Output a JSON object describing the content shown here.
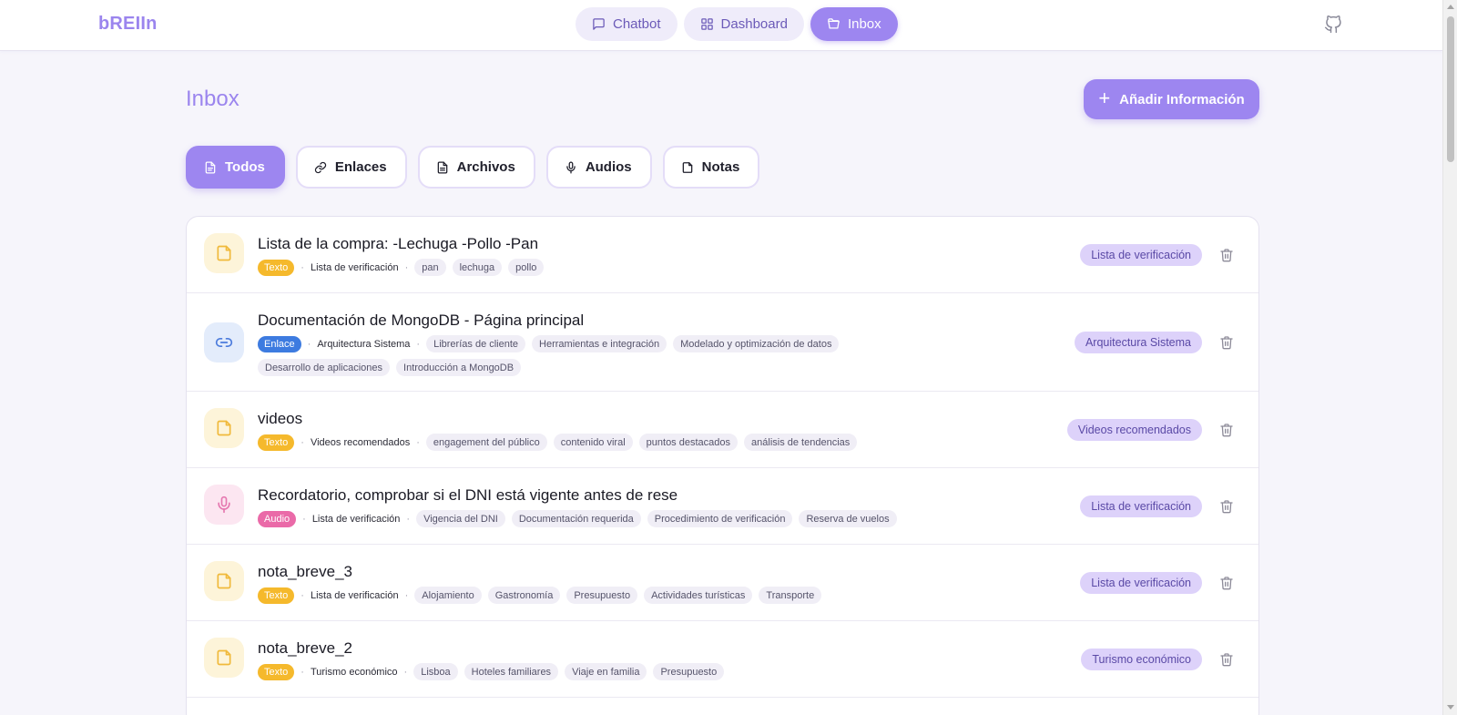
{
  "brand": "bREIIn",
  "nav": [
    {
      "label": "Chatbot",
      "icon": "chat-icon"
    },
    {
      "label": "Dashboard",
      "icon": "dashboard-icon"
    },
    {
      "label": "Inbox",
      "icon": "folder-open-icon"
    }
  ],
  "page": {
    "title": "Inbox",
    "add_button": "Añadir Información"
  },
  "filters": [
    {
      "label": "Todos",
      "icon": "document-icon",
      "active": true
    },
    {
      "label": "Enlaces",
      "icon": "link-icon"
    },
    {
      "label": "Archivos",
      "icon": "file-text-icon"
    },
    {
      "label": "Audios",
      "icon": "mic-icon"
    },
    {
      "label": "Notas",
      "icon": "note-icon"
    }
  ],
  "items": [
    {
      "title": "Lista de la compra: -Lechuga -Pollo -Pan",
      "type": "Texto",
      "category": "Lista de verificación",
      "tags": [
        "pan",
        "lechuga",
        "pollo"
      ],
      "pill": "Lista de verificación"
    },
    {
      "title": "Documentación de MongoDB - Página principal",
      "type": "Enlace",
      "category": "Arquitectura Sistema",
      "tags": [
        "Librerías de cliente",
        "Herramientas e integración",
        "Modelado y optimización de datos",
        "Desarrollo de aplicaciones",
        "Introducción a MongoDB"
      ],
      "pill": "Arquitectura Sistema"
    },
    {
      "title": "videos",
      "type": "Texto",
      "category": "Videos recomendados",
      "tags": [
        "engagement del público",
        "contenido viral",
        "puntos destacados",
        "análisis de tendencias"
      ],
      "pill": "Videos recomendados"
    },
    {
      "title": "Recordatorio, comprobar si el DNI está vigente antes de rese",
      "type": "Audio",
      "category": "Lista de verificación",
      "tags": [
        "Vigencia del DNI",
        "Documentación requerida",
        "Procedimiento de verificación",
        "Reserva de vuelos"
      ],
      "pill": "Lista de verificación"
    },
    {
      "title": "nota_breve_3",
      "type": "Texto",
      "category": "Lista de verificación",
      "tags": [
        "Alojamiento",
        "Gastronomía",
        "Presupuesto",
        "Actividades turísticas",
        "Transporte"
      ],
      "pill": "Lista de verificación"
    },
    {
      "title": "nota_breve_2",
      "type": "Texto",
      "category": "Turismo económico",
      "tags": [
        "Lisboa",
        "Hoteles familiares",
        "Viaje en familia",
        "Presupuesto"
      ],
      "pill": "Turismo económico"
    }
  ],
  "colors": {
    "accent": "#9d86f0",
    "badge_texto": "#f5b92c",
    "badge_enlace": "#3d7be0",
    "badge_audio": "#ea6aa8"
  }
}
